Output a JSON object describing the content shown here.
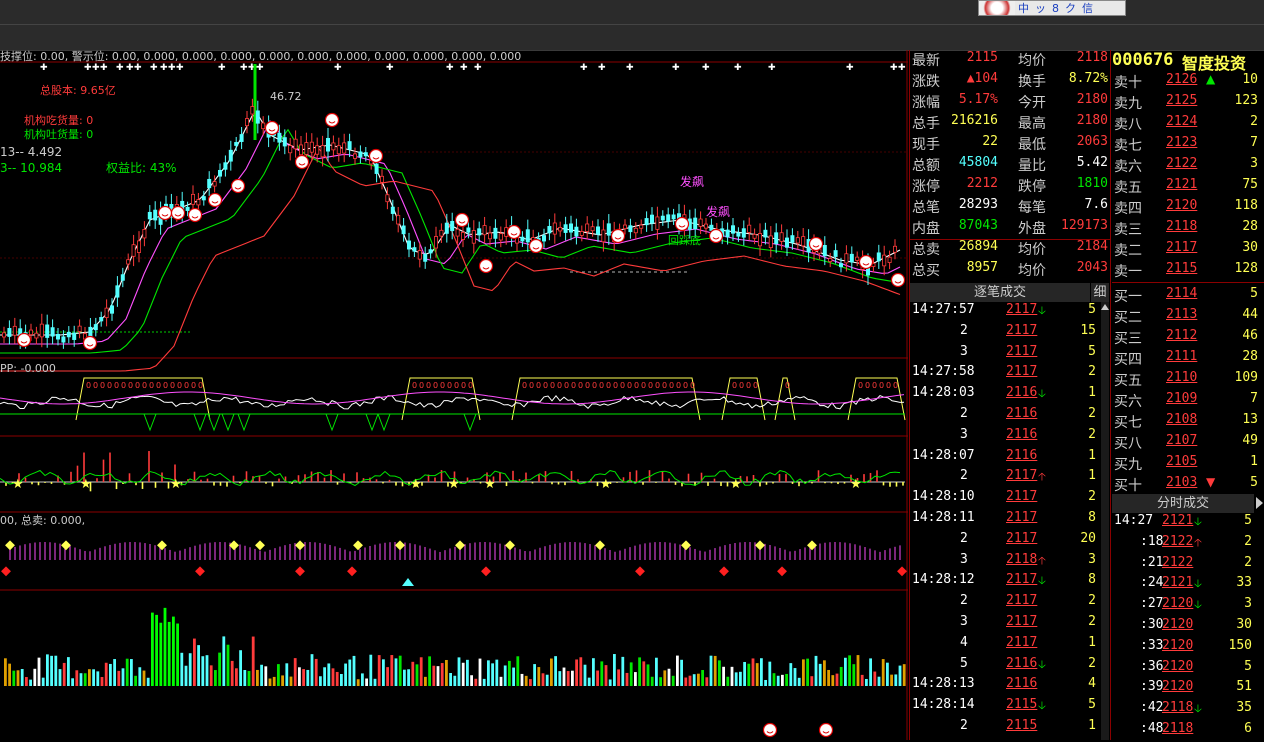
{
  "toolbar": {
    "b1": "中",
    "b2": "ッ",
    "b3": "8",
    "b4": "ク",
    "b5": "信"
  },
  "stock": {
    "code": "000676",
    "name": "智度投资"
  },
  "chart": {
    "header": "技撑位: 0.00, 警示位: 0.00, 0.000, 0.000, 0.000, 0.000, 0.000, 0.000, 0.000, 0.000, 0.000, 0.000",
    "total_share": "总股本: 9.65亿",
    "inst_in": "机构吃货量: 0",
    "inst_out": "机构吐货量: 0",
    "line13": "13-- 4.492",
    "line3": "3-- 10.984",
    "equity": "权益比: 43%",
    "peak": "46.72",
    "pp": "PP: -0.000",
    "sell_hdr": "00, 总卖: 0.000,",
    "ann1": "发飙",
    "ann2": "发飙",
    "ann3": "回踩底"
  },
  "quote": [
    {
      "l": "最新",
      "v": "2115",
      "c": "red",
      "l2": "均价",
      "v2": "2118",
      "c2": "red"
    },
    {
      "l": "涨跌",
      "v": "▲104",
      "c": "red",
      "l2": "换手",
      "v2": "8.72%",
      "c2": "yel"
    },
    {
      "l": "涨幅",
      "v": "5.17%",
      "c": "red",
      "l2": "今开",
      "v2": "2180",
      "c2": "red"
    },
    {
      "l": "总手",
      "v": "216216",
      "c": "yel",
      "l2": "最高",
      "v2": "2180",
      "c2": "red"
    },
    {
      "l": "现手",
      "v": "22",
      "c": "yel",
      "l2": "最低",
      "v2": "2063",
      "c2": "red"
    },
    {
      "l": "总额",
      "v": "45804",
      "c": "cyn",
      "l2": "量比",
      "v2": "5.42",
      "c2": "wht"
    },
    {
      "l": "涨停",
      "v": "2212",
      "c": "red",
      "l2": "跌停",
      "v2": "1810",
      "c2": "grn"
    },
    {
      "l": "总笔",
      "v": "28293",
      "c": "wht",
      "l2": "每笔",
      "v2": "7.6",
      "c2": "wht"
    },
    {
      "l": "内盘",
      "v": "87043",
      "c": "grn",
      "l2": "外盘",
      "v2": "129173",
      "c2": "red"
    },
    {
      "l": "总卖",
      "v": "26894",
      "c": "yel",
      "l2": "均价",
      "v2": "2184",
      "c2": "red"
    },
    {
      "l": "总买",
      "v": "8957",
      "c": "yel",
      "l2": "均价",
      "v2": "2043",
      "c2": "red"
    }
  ],
  "orderbook": {
    "asks": [
      {
        "l": "卖十",
        "p": "2126",
        "q": "10",
        "ar": "up"
      },
      {
        "l": "卖九",
        "p": "2125",
        "q": "123"
      },
      {
        "l": "卖八",
        "p": "2124",
        "q": "2"
      },
      {
        "l": "卖七",
        "p": "2123",
        "q": "7"
      },
      {
        "l": "卖六",
        "p": "2122",
        "q": "3"
      },
      {
        "l": "卖五",
        "p": "2121",
        "q": "75"
      },
      {
        "l": "卖四",
        "p": "2120",
        "q": "118"
      },
      {
        "l": "卖三",
        "p": "2118",
        "q": "28"
      },
      {
        "l": "卖二",
        "p": "2117",
        "q": "30"
      },
      {
        "l": "卖一",
        "p": "2115",
        "q": "128"
      }
    ],
    "bids": [
      {
        "l": "买一",
        "p": "2114",
        "q": "5"
      },
      {
        "l": "买二",
        "p": "2113",
        "q": "44"
      },
      {
        "l": "买三",
        "p": "2112",
        "q": "46"
      },
      {
        "l": "买四",
        "p": "2111",
        "q": "28"
      },
      {
        "l": "买五",
        "p": "2110",
        "q": "109"
      },
      {
        "l": "买六",
        "p": "2109",
        "q": "7"
      },
      {
        "l": "买七",
        "p": "2108",
        "q": "13"
      },
      {
        "l": "买八",
        "p": "2107",
        "q": "49"
      },
      {
        "l": "买九",
        "p": "2105",
        "q": "1"
      },
      {
        "l": "买十",
        "p": "2103",
        "q": "5",
        "ar": "down"
      }
    ]
  },
  "trades_hdr": "逐笔成交",
  "trades_btn": "细",
  "trades": [
    {
      "t": "14:27:57",
      "p": "2117",
      "a": "down",
      "q": "5"
    },
    {
      "t": "2",
      "p": "2117",
      "a": "",
      "q": "15"
    },
    {
      "t": "3",
      "p": "2117",
      "a": "",
      "q": "5"
    },
    {
      "t": "14:27:58",
      "p": "2117",
      "a": "",
      "q": "2"
    },
    {
      "t": "14:28:03",
      "p": "2116",
      "a": "down",
      "q": "1"
    },
    {
      "t": "2",
      "p": "2116",
      "a": "",
      "q": "2"
    },
    {
      "t": "3",
      "p": "2116",
      "a": "",
      "q": "2"
    },
    {
      "t": "14:28:07",
      "p": "2116",
      "a": "",
      "q": "1"
    },
    {
      "t": "2",
      "p": "2117",
      "a": "up",
      "q": "1"
    },
    {
      "t": "14:28:10",
      "p": "2117",
      "a": "",
      "q": "2"
    },
    {
      "t": "14:28:11",
      "p": "2117",
      "a": "",
      "q": "8"
    },
    {
      "t": "2",
      "p": "2117",
      "a": "",
      "q": "20"
    },
    {
      "t": "3",
      "p": "2118",
      "a": "up",
      "q": "3"
    },
    {
      "t": "14:28:12",
      "p": "2117",
      "a": "down",
      "q": "8"
    },
    {
      "t": "2",
      "p": "2117",
      "a": "",
      "q": "2"
    },
    {
      "t": "3",
      "p": "2117",
      "a": "",
      "q": "2"
    },
    {
      "t": "4",
      "p": "2117",
      "a": "",
      "q": "1"
    },
    {
      "t": "5",
      "p": "2116",
      "a": "down",
      "q": "2"
    },
    {
      "t": "14:28:13",
      "p": "2116",
      "a": "",
      "q": "4"
    },
    {
      "t": "14:28:14",
      "p": "2115",
      "a": "down",
      "q": "5"
    },
    {
      "t": "2",
      "p": "2115",
      "a": "",
      "q": "1"
    }
  ],
  "min_hdr": "分时成交",
  "minute": [
    {
      "t": "14:27",
      "p": "2121",
      "a": "down",
      "q": "5"
    },
    {
      "t": ":18",
      "p": "2122",
      "a": "up",
      "q": "2"
    },
    {
      "t": ":21",
      "p": "2122",
      "a": "",
      "q": "2"
    },
    {
      "t": ":24",
      "p": "2121",
      "a": "down",
      "q": "33"
    },
    {
      "t": ":27",
      "p": "2120",
      "a": "down",
      "q": "3"
    },
    {
      "t": ":30",
      "p": "2120",
      "a": "",
      "q": "30"
    },
    {
      "t": ":33",
      "p": "2120",
      "a": "",
      "q": "150"
    },
    {
      "t": ":36",
      "p": "2120",
      "a": "",
      "q": "5"
    },
    {
      "t": ":39",
      "p": "2120",
      "a": "",
      "q": "51"
    },
    {
      "t": ":42",
      "p": "2118",
      "a": "down",
      "q": "35"
    },
    {
      "t": ":48",
      "p": "2118",
      "a": "",
      "q": "6"
    }
  ]
}
